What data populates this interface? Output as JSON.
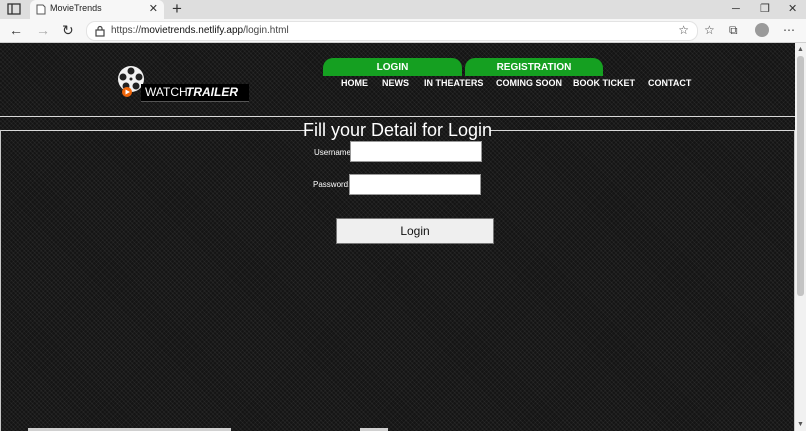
{
  "browser": {
    "tab_title": "MovieTrends",
    "url_protocol": "https://",
    "url_host": "movietrends.netlify.app",
    "url_path": "/login.html",
    "icons": [
      "tab-actions-icon",
      "favicon-icon",
      "close-icon",
      "new-tab-icon",
      "minimize-icon",
      "maximize-icon",
      "window-close-icon",
      "back-icon",
      "forward-icon",
      "refresh-icon",
      "lock-icon",
      "add-favorite-icon",
      "favorites-icon",
      "collections-icon",
      "profile-icon",
      "more-icon"
    ]
  },
  "site": {
    "logo": {
      "word1": "WATCH",
      "word2": "TRAILER",
      "icon": "film-reel-icon"
    },
    "auth_tabs": {
      "login": "LOGIN",
      "registration": "REGISTRATION"
    },
    "nav": [
      "HOME",
      "NEWS",
      "IN THEATERS",
      "COMING SOON",
      "BOOK TICKET",
      "CONTACT"
    ],
    "accent_color": "#15a021"
  },
  "form": {
    "legend": "Fill your Detail for Login",
    "username_label": "Username:",
    "username_value": "",
    "password_label": "Password:",
    "password_value": "",
    "submit_label": "Login"
  }
}
